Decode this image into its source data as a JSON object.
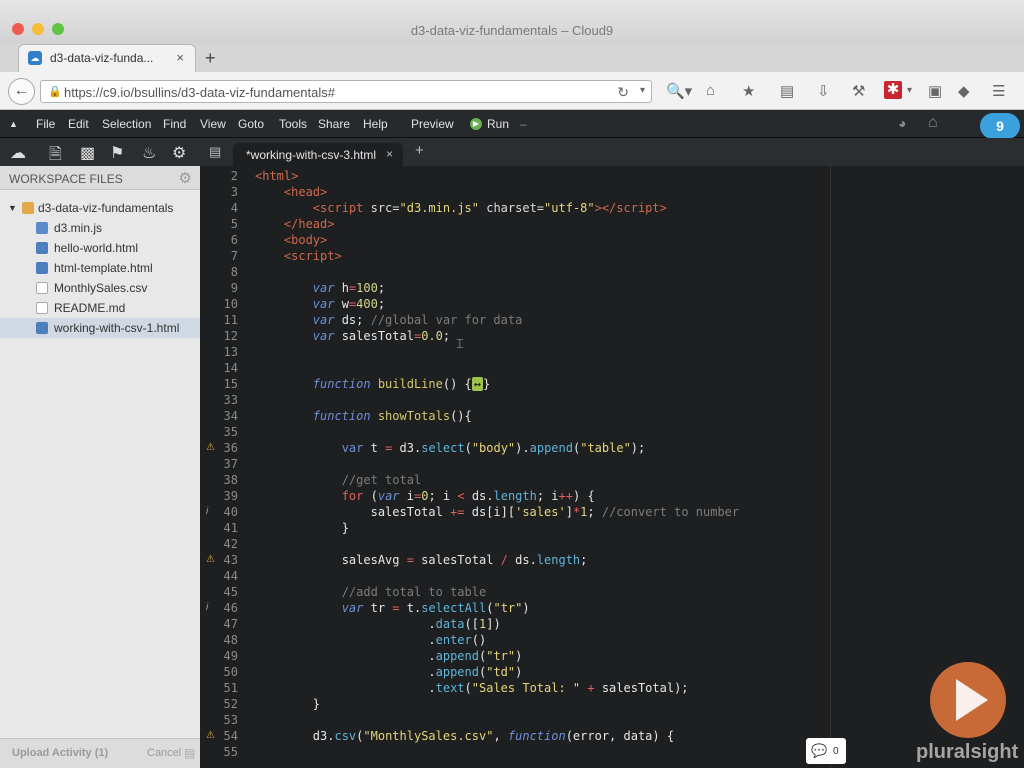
{
  "window": {
    "title": "d3-data-viz-fundamentals – Cloud9"
  },
  "browser": {
    "tab_label": "d3-data-viz-funda...",
    "url": "https://c9.io/bsullins/d3-data-viz-fundamentals#"
  },
  "menu": [
    "File",
    "Edit",
    "Selection",
    "Find",
    "View",
    "Goto",
    "Tools",
    "Share",
    "Help"
  ],
  "preview_label": "Preview",
  "run_label": "Run",
  "sidebar": {
    "title": "WORKSPACE FILES",
    "root": "d3-data-viz-fundamentals",
    "files": [
      {
        "name": "d3.min.js",
        "icon": "js-file-icon"
      },
      {
        "name": "hello-world.html",
        "icon": "html-file-icon"
      },
      {
        "name": "html-template.html",
        "icon": "html-file-icon"
      },
      {
        "name": "MonthlySales.csv",
        "icon": "file-icon"
      },
      {
        "name": "README.md",
        "icon": "file-icon"
      },
      {
        "name": "working-with-csv-1.html",
        "icon": "html-file-icon"
      }
    ],
    "upload_label": "Upload Activity (1)",
    "cancel_label": "Cancel"
  },
  "editor": {
    "tab_label": "*working-with-csv-3.html",
    "lines": [
      {
        "n": "2"
      },
      {
        "n": "3"
      },
      {
        "n": "4"
      },
      {
        "n": "5"
      },
      {
        "n": "6"
      },
      {
        "n": "7"
      },
      {
        "n": "8"
      },
      {
        "n": "9"
      },
      {
        "n": "10"
      },
      {
        "n": "11"
      },
      {
        "n": "12"
      },
      {
        "n": "13"
      },
      {
        "n": "14"
      },
      {
        "n": "15"
      },
      {
        "n": "33"
      },
      {
        "n": "34"
      },
      {
        "n": "35"
      },
      {
        "n": "36",
        "ann": "warning"
      },
      {
        "n": "37"
      },
      {
        "n": "38"
      },
      {
        "n": "39"
      },
      {
        "n": "40",
        "ann": "info"
      },
      {
        "n": "41"
      },
      {
        "n": "42"
      },
      {
        "n": "43",
        "ann": "warning"
      },
      {
        "n": "44"
      },
      {
        "n": "45"
      },
      {
        "n": "46",
        "ann": "info"
      },
      {
        "n": "47"
      },
      {
        "n": "48"
      },
      {
        "n": "49"
      },
      {
        "n": "50"
      },
      {
        "n": "51"
      },
      {
        "n": "52"
      },
      {
        "n": "53"
      },
      {
        "n": "54",
        "ann": "warning"
      },
      {
        "n": "55"
      }
    ]
  },
  "chat_count": "0",
  "brand": "pluralsight",
  "colors": {
    "warning": "#e0b040",
    "info": "#9aa6b8"
  }
}
